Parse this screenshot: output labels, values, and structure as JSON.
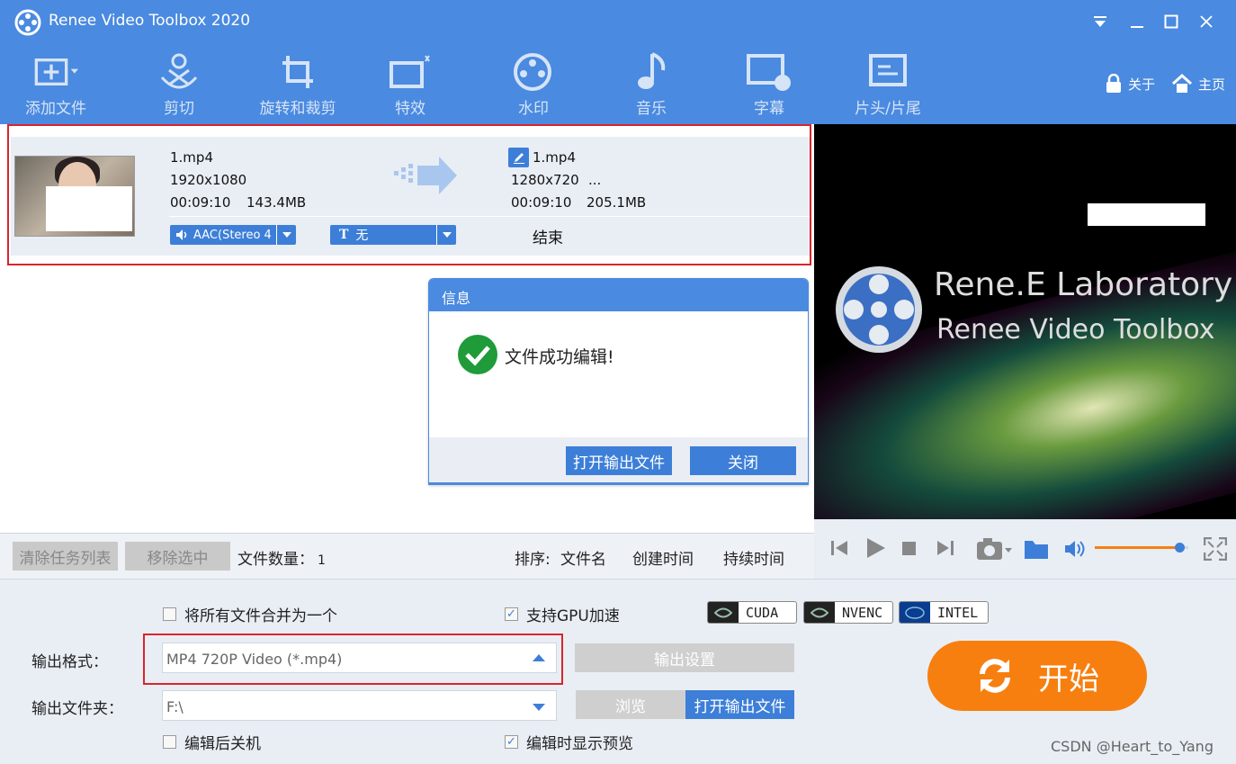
{
  "window": {
    "title": "Renee Video Toolbox 2020"
  },
  "toolbar": {
    "items": [
      {
        "label": "添加文件",
        "icon": "add-file-icon"
      },
      {
        "label": "剪切",
        "icon": "cut-icon"
      },
      {
        "label": "旋转和裁剪",
        "icon": "rotate-crop-icon"
      },
      {
        "label": "特效",
        "icon": "effects-icon"
      },
      {
        "label": "水印",
        "icon": "watermark-icon"
      },
      {
        "label": "音乐",
        "icon": "music-icon"
      },
      {
        "label": "字幕",
        "icon": "subtitle-icon"
      },
      {
        "label": "片头/片尾",
        "icon": "intro-outro-icon"
      }
    ],
    "about": "关于",
    "home": "主页"
  },
  "file": {
    "src_name": "1.mp4",
    "src_resolution": "1920x1080",
    "src_duration": "00:09:10",
    "src_size": "143.4MB",
    "out_name": "1.mp4",
    "out_resolution": "1280x720",
    "out_more": "...",
    "out_duration": "00:09:10",
    "out_size": "205.1MB",
    "audio_track": "AAC(Stereo 4",
    "subtitle_track": "无",
    "status": "结束"
  },
  "dialog": {
    "title": "信息",
    "message": "文件成功编辑!",
    "open_output_btn": "打开输出文件",
    "close_btn": "关闭"
  },
  "preview": {
    "brand_line1": "Rene.E Laboratory",
    "brand_line2": "Renee Video Toolbox",
    "volume": 0.9
  },
  "listbar": {
    "clear_btn": "清除任务列表",
    "remove_btn": "移除选中",
    "count_label": "文件数量：",
    "count_value": "1",
    "sort_label": "排序:",
    "sort_name": "文件名",
    "sort_created": "创建时间",
    "sort_duration": "持续时间"
  },
  "settings": {
    "merge_label": "将所有文件合并为一个",
    "merge_checked": false,
    "gpu_label": "支持GPU加速",
    "gpu_checked": true,
    "gpu_badges": [
      "CUDA",
      "NVENC",
      "INTEL"
    ],
    "output_format_label": "输出格式：",
    "output_format_value": "MP4 720P Video (*.mp4)",
    "output_settings_btn": "输出设置",
    "output_folder_label": "输出文件夹：",
    "output_folder_value": "F:\\",
    "browse_btn": "浏览",
    "open_folder_btn": "打开输出文件",
    "shutdown_label": "编辑后关机",
    "shutdown_checked": false,
    "preview_label": "编辑时显示预览",
    "preview_checked": true,
    "start_btn": "开始"
  },
  "watermark": "CSDN @Heart_to_Yang",
  "colors": {
    "primary": "#4a8ae0",
    "accent": "#3d7fd8",
    "start": "#f77f10",
    "highlight": "#d9252b"
  }
}
